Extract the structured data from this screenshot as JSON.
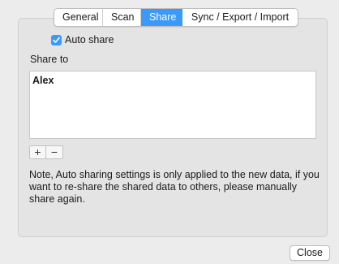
{
  "tabs": [
    {
      "label": "General",
      "active": false
    },
    {
      "label": "Scan",
      "active": false
    },
    {
      "label": "Share",
      "active": true
    },
    {
      "label": "Sync / Export / Import",
      "active": false
    }
  ],
  "auto_share": {
    "label": "Auto share",
    "checked": true
  },
  "share_to": {
    "label": "Share to",
    "items": [
      "Alex"
    ]
  },
  "stepper": {
    "add": "+",
    "remove": "−"
  },
  "note": "Note, Auto sharing settings is only applied to the new data, if you want to re-share the shared data to others, please manually share again.",
  "close_label": "Close",
  "colors": {
    "accent": "#3b99fc"
  }
}
